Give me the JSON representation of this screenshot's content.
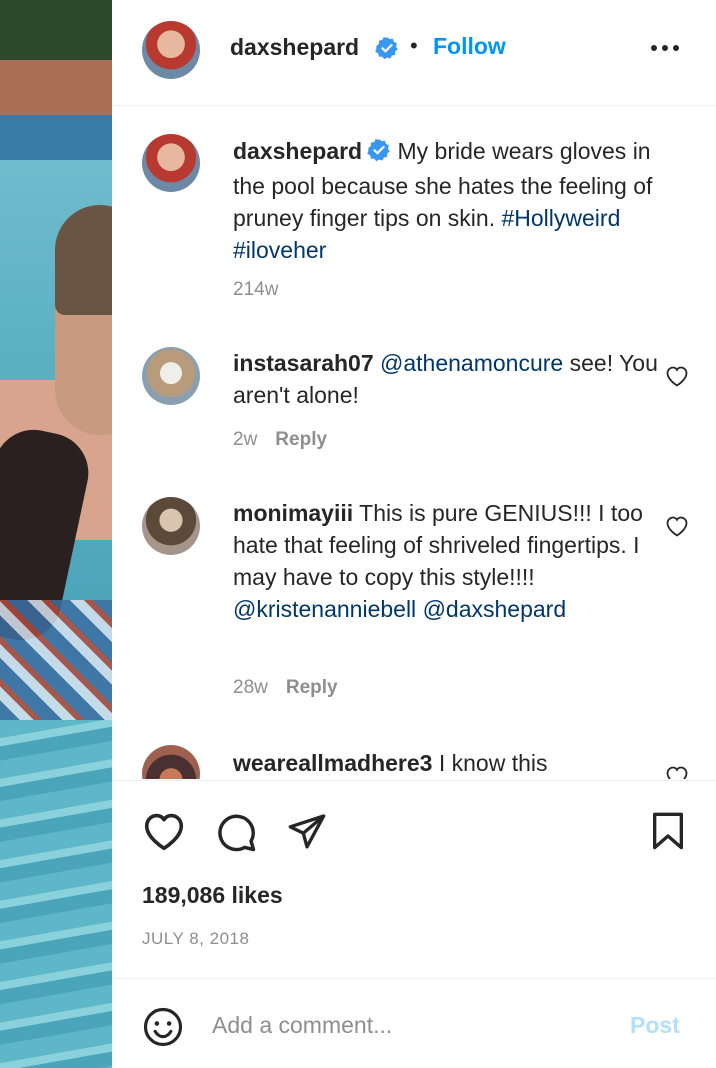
{
  "post": {
    "author": "daxshepard",
    "follow_label": "Follow",
    "separator": "•",
    "caption_text": "My bride wears gloves in the pool because she hates the feeling of pruney finger tips on skin.",
    "hashtags": [
      "#Hollyweird",
      "#iloveher"
    ],
    "caption_age": "214w",
    "likes": "189,086 likes",
    "date": "JULY 8, 2018"
  },
  "comments": [
    {
      "username": "instasarah07",
      "mention": "@athenamoncure",
      "text": "see! You aren't alone!",
      "age": "2w",
      "reply_label": "Reply"
    },
    {
      "username": "monimayiii",
      "text": "This is pure GENIUS!!! I too hate that feeling of shriveled fingertips. I may have to copy this style!!!!",
      "mentions": [
        "@kristenanniebell",
        "@daxshepard"
      ],
      "age": "28w",
      "reply_label": "Reply"
    },
    {
      "username": "weareallmadhere3",
      "text": "I know this"
    }
  ],
  "add_comment": {
    "placeholder": "Add a comment...",
    "post_label": "Post"
  },
  "colors": {
    "accent": "#0095f6",
    "link": "#00376b",
    "muted": "#8e8e8e",
    "post_disabled": "#b2dffc",
    "verified": "#3897f0"
  },
  "icons": [
    "verified-badge-icon",
    "more-options-icon",
    "heart-icon",
    "comment-icon",
    "share-icon",
    "bookmark-icon",
    "emoji-icon"
  ]
}
